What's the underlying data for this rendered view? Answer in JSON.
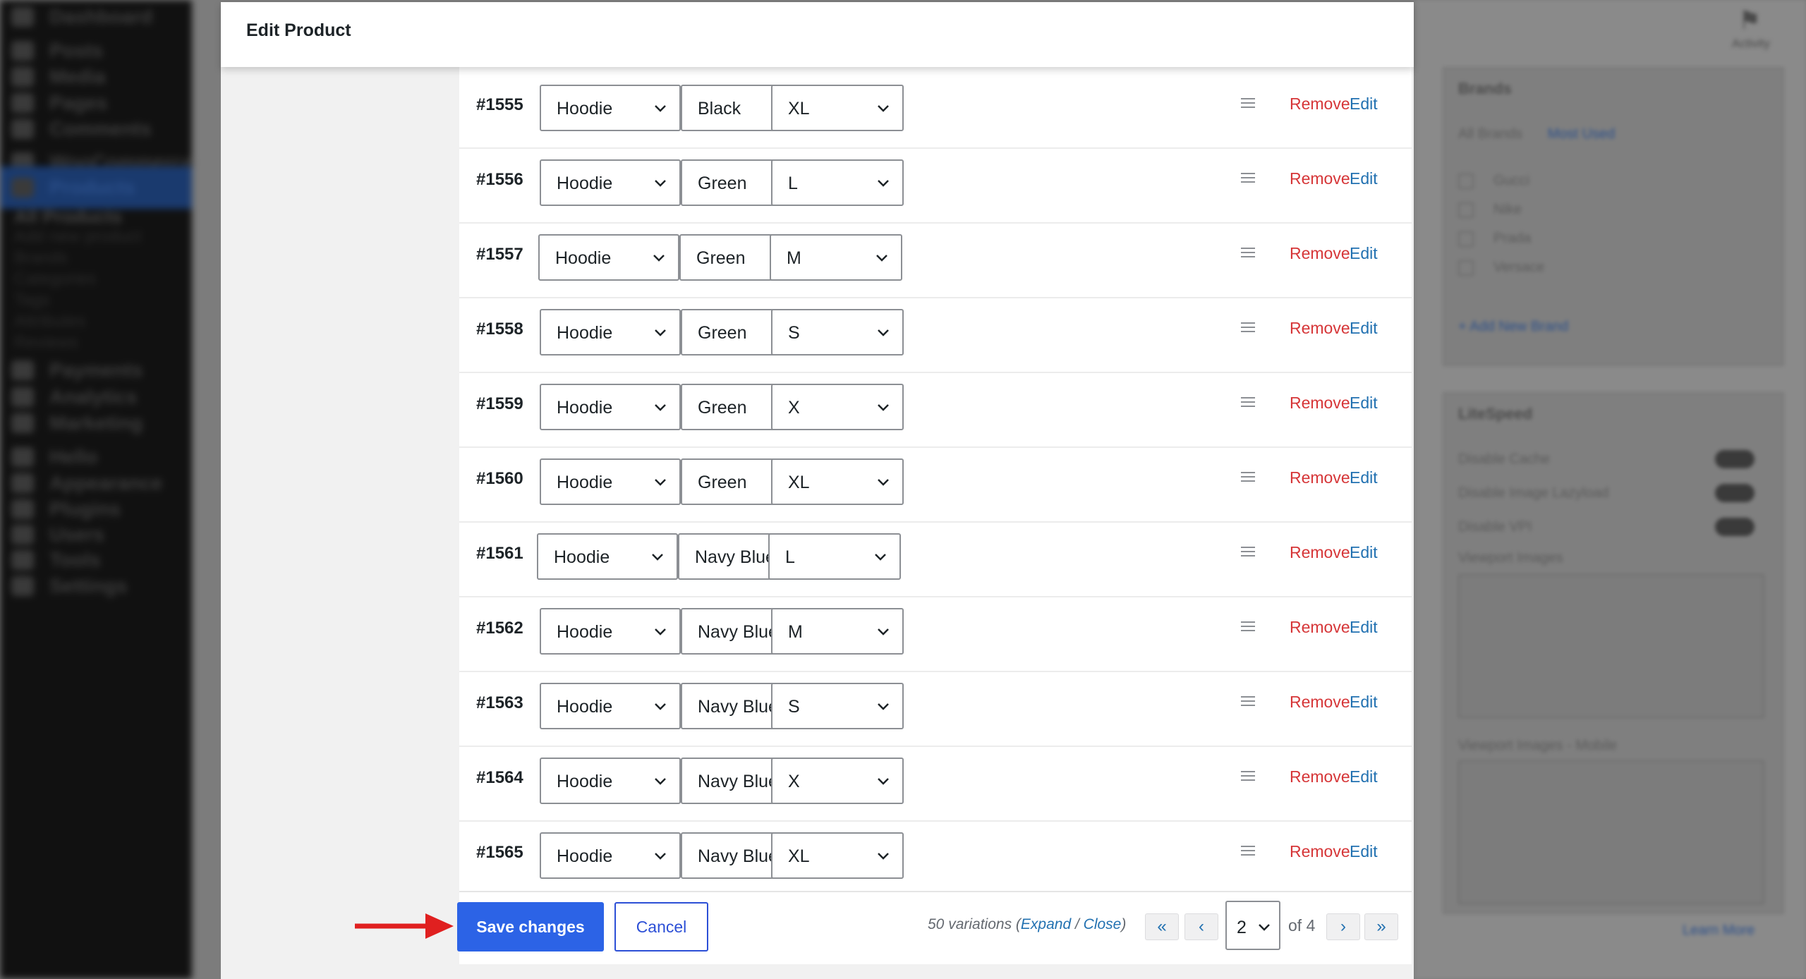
{
  "modal": {
    "title": "Edit Product"
  },
  "variations": [
    {
      "id": "#1555",
      "attr1": "Hoodie",
      "attr2": "Black",
      "attr3": "XL"
    },
    {
      "id": "#1556",
      "attr1": "Hoodie",
      "attr2": "Green",
      "attr3": "L"
    },
    {
      "id": "#1557",
      "attr1": "Hoodie",
      "attr2": "Green",
      "attr3": "M"
    },
    {
      "id": "#1558",
      "attr1": "Hoodie",
      "attr2": "Green",
      "attr3": "S"
    },
    {
      "id": "#1559",
      "attr1": "Hoodie",
      "attr2": "Green",
      "attr3": "X"
    },
    {
      "id": "#1560",
      "attr1": "Hoodie",
      "attr2": "Green",
      "attr3": "XL"
    },
    {
      "id": "#1561",
      "attr1": "Hoodie",
      "attr2": "Navy Blue",
      "attr3": "L"
    },
    {
      "id": "#1562",
      "attr1": "Hoodie",
      "attr2": "Navy Blue",
      "attr3": "M"
    },
    {
      "id": "#1563",
      "attr1": "Hoodie",
      "attr2": "Navy Blue",
      "attr3": "S"
    },
    {
      "id": "#1564",
      "attr1": "Hoodie",
      "attr2": "Navy Blue",
      "attr3": "X"
    },
    {
      "id": "#1565",
      "attr1": "Hoodie",
      "attr2": "Navy Blue",
      "attr3": "XL"
    }
  ],
  "row_actions": {
    "remove_label": "Remove",
    "edit_label": "Edit"
  },
  "footer": {
    "save_label": "Save changes",
    "cancel_label": "Cancel",
    "count_text": "50 variations",
    "open_paren": "(",
    "expand_label": "Expand",
    "separator": " / ",
    "close_label": "Close",
    "close_paren": ")",
    "first_page": "«",
    "prev_page": "‹",
    "current_page": "2",
    "of_pages": "of 4",
    "next_page": "›",
    "last_page": "»"
  },
  "admin_sidebar": {
    "items": [
      "Dashboard",
      "Posts",
      "Media",
      "Pages",
      "Comments",
      "WooCommerce",
      "Products",
      "Payments",
      "Analytics",
      "Marketing",
      "Hello",
      "Appearance",
      "Plugins",
      "Users",
      "Tools",
      "Settings"
    ],
    "sub_items": [
      "All Products",
      "Add new product",
      "Brands",
      "Categories",
      "Tags",
      "Attributes",
      "Reviews"
    ]
  },
  "right_panel": {
    "activity_label": "Activity",
    "brands_title": "Brands",
    "brands_tab_all": "All Brands",
    "brands_tab_used": "Most Used",
    "brands_options": [
      "Gucci",
      "Nike",
      "Prada",
      "Versace"
    ],
    "add_brand": "+ Add New Brand",
    "litespeed_title": "LiteSpeed",
    "litespeed_options": [
      "Disable Cache",
      "Disable Image Lazyload",
      "Disable VPI"
    ],
    "viewport_label": "Viewport Images",
    "viewport_mobile_label": "Viewport Images - Mobile",
    "learn_more": "Learn More"
  },
  "colors": {
    "primary": "#2c63e6",
    "remove": "#d63638",
    "link": "#2271b1",
    "arrow": "#e02020"
  }
}
